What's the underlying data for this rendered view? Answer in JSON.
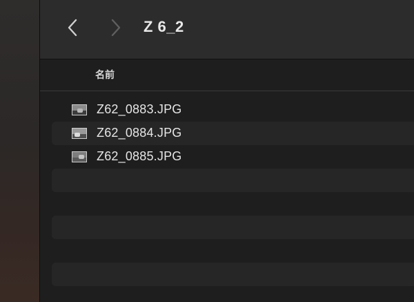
{
  "toolbar": {
    "back_icon": "chevron-left-icon",
    "forward_icon": "chevron-right-icon",
    "folder_title": "Z 6_2"
  },
  "columns": {
    "name_header": "名前"
  },
  "files": [
    {
      "name": "Z62_0883.JPG",
      "icon": "image-thumbnail-icon"
    },
    {
      "name": "Z62_0884.JPG",
      "icon": "image-thumbnail-icon"
    },
    {
      "name": "Z62_0885.JPG",
      "icon": "image-thumbnail-icon"
    }
  ],
  "colors": {
    "window_bg": "#1e1e1e",
    "toolbar_bg": "#2c2c2c",
    "alt_row_bg": "#262626",
    "text": "#e6e6e6"
  }
}
